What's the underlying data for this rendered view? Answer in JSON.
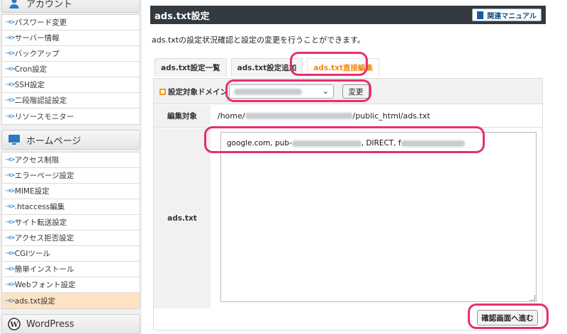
{
  "sidebar": {
    "account_title": "アカウント",
    "account_items": [
      {
        "label": "パスワード変更"
      },
      {
        "label": "サーバー情報"
      },
      {
        "label": "バックアップ"
      },
      {
        "label": "Cron設定"
      },
      {
        "label": "SSH設定"
      },
      {
        "label": "二段階認証設定"
      },
      {
        "label": "リソースモニター"
      }
    ],
    "homepage_title": "ホームページ",
    "homepage_items": [
      {
        "label": "アクセス制限"
      },
      {
        "label": "エラーページ設定"
      },
      {
        "label": "MIME設定"
      },
      {
        "label": ".htaccess編集"
      },
      {
        "label": "サイト転送設定"
      },
      {
        "label": "アクセス拒否設定"
      },
      {
        "label": "CGIツール"
      },
      {
        "label": "簡単インストール"
      },
      {
        "label": "Webフォント設定"
      },
      {
        "label": "ads.txt設定",
        "active": true
      }
    ],
    "wordpress_title": "WordPress"
  },
  "main": {
    "title": "ads.txt設定",
    "manual_label": "関連マニュアル",
    "description": "ads.txtの設定状況確認と設定の変更を行うことができます。",
    "tabs": [
      {
        "label": "ads.txt設定一覧"
      },
      {
        "label": "ads.txt設定追加"
      },
      {
        "label": "ads.txt直接編集",
        "active": true
      }
    ],
    "domain_label": "設定対象ドメイン",
    "change_button": "変更",
    "target_label": "編集対象",
    "path_prefix": "/home/",
    "path_suffix": "/public_html/ads.txt",
    "ads_label": "ads.txt",
    "ads_line_prefix": "google.com, pub-",
    "ads_line_middle": ", DIRECT, f",
    "confirm_button": "確認画面へ進む"
  },
  "colors": {
    "highlight": "#e82d6f",
    "active_tab_text": "#f08a12",
    "title_bar": "#333a40",
    "active_menu": "#fde3c4"
  }
}
